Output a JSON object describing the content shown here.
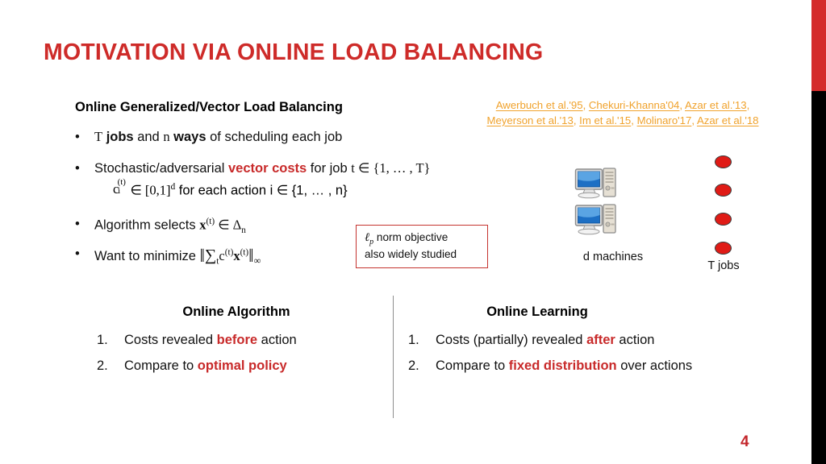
{
  "title": "MOTIVATION VIA ONLINE LOAD BALANCING",
  "body": {
    "lead_heading": "Online Generalized/Vector Load Balancing",
    "bullet_marker": "•",
    "bullet1": {
      "var_T": "T",
      "word_jobs": "jobs",
      "and": " and ",
      "var_n": "n",
      "word_ways": "ways",
      "tail": " of scheduling each job"
    },
    "bullet2": {
      "pre": "Stochastic/adversarial ",
      "highlight": "vector costs",
      "post": " for job ",
      "var_t": "t",
      "set_tail": " ∈ {1, … , T}",
      "line2_base": "c",
      "line2_sup": "(t)",
      "line2_sub": "i",
      "line2_rest": " ∈ [0,1]",
      "line2_exp": "d",
      "line2_tail": " for each action i ∈ {1, … , n}"
    },
    "bullet3": {
      "pre": "Algorithm selects ",
      "var_x": "x",
      "sup": "(t)",
      "mid": " ∈ Δ",
      "sub": "n"
    },
    "bullet4": {
      "pre": "Want to minimize ",
      "bar_open": "‖",
      "sum": "∑",
      "sum_sub": "t",
      "cost": "c",
      "cost_sup": "(t)",
      "var_x": "x",
      "x_sup": "(t)",
      "bar_close": "‖",
      "norm_sub": "∞"
    }
  },
  "citations": {
    "separator": ", ",
    "line1": [
      "Awerbuch et al.'95",
      "Chekuri-Khanna'04",
      "Azar et al.'13"
    ],
    "line2": [
      "Meyerson et al.'13",
      "Im et al.'15",
      "Molinaro'17",
      "Azar et al.'18"
    ]
  },
  "callout": {
    "ell": "ℓ",
    "ell_sub": "p",
    "line1_rest": " norm objective",
    "line2": "also widely studied"
  },
  "diagram": {
    "machines_label": "d machines",
    "jobs_label": "T jobs",
    "machine_count": 2,
    "job_count": 4
  },
  "columns": {
    "left": {
      "heading": "Online Algorithm",
      "items": [
        {
          "num": "1.",
          "pre": "Costs revealed ",
          "highlight": "before",
          "post": " action"
        },
        {
          "num": "2.",
          "pre": "Compare to ",
          "highlight": "optimal policy",
          "post": ""
        }
      ]
    },
    "right": {
      "heading": "Online Learning",
      "items": [
        {
          "num": "1.",
          "pre": "Costs (partially) revealed ",
          "highlight": "after",
          "post": " action"
        },
        {
          "num": "2.",
          "pre": "Compare to ",
          "highlight": "fixed distribution",
          "post": " over actions"
        }
      ]
    }
  },
  "page_number": "4",
  "colors": {
    "title_red": "#CE2B29",
    "accent_red": "#C82A2A",
    "citation_amber": "#F0A22C",
    "edge_red": "#D42C2C",
    "edge_black": "#000000",
    "job_dot_red": "#E01B16"
  }
}
